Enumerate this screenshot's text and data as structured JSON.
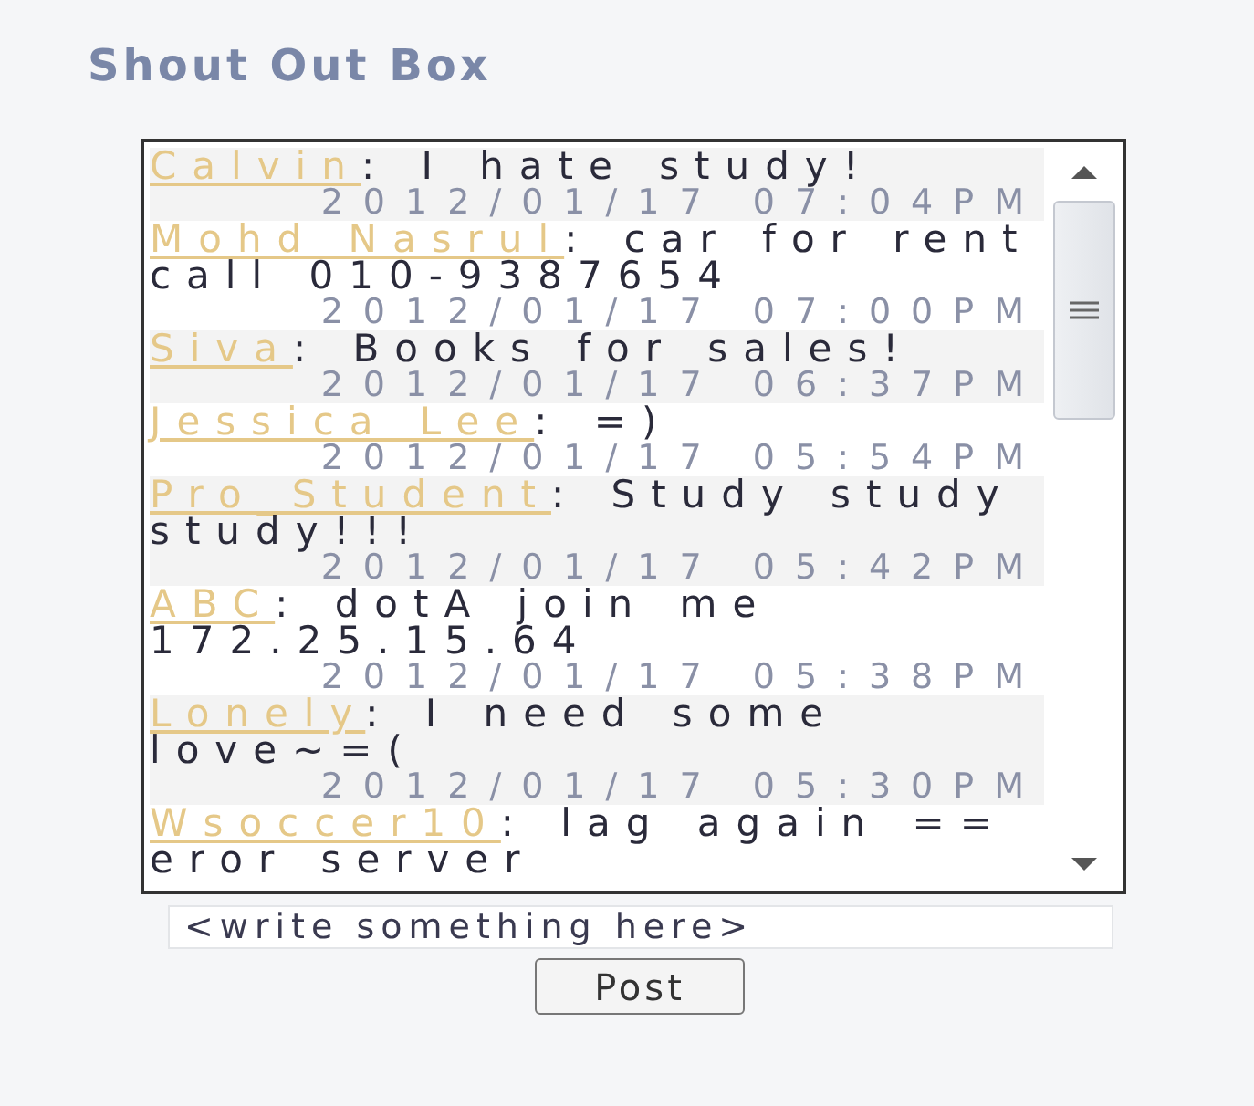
{
  "title": "Shout Out Box",
  "messages": [
    {
      "name": "Calvin",
      "text": ": I hate study!",
      "time": "2012/01/17 07:04PM"
    },
    {
      "name": "Mohd Nasrul",
      "text": ": car for rent call 010-9387654",
      "time": "2012/01/17 07:00PM"
    },
    {
      "name": "Siva",
      "text": ": Books for sales!",
      "time": "2012/01/17 06:37PM"
    },
    {
      "name": "Jessica Lee",
      "text": ": =)",
      "time": "2012/01/17 05:54PM"
    },
    {
      "name": "Pro_Student",
      "text": ": Study study study!!!",
      "time": "2012/01/17 05:42PM"
    },
    {
      "name": "ABC",
      "text": ": dotA join me 172.25.15.64",
      "time": "2012/01/17 05:38PM"
    },
    {
      "name": "Lonely",
      "text": ": I need some love~=(",
      "time": "2012/01/17 05:30PM"
    },
    {
      "name": "Wsoccer10",
      "text": ": lag again == eror server"
    }
  ],
  "input": {
    "placeholder": "<write something here>"
  },
  "button": "Post"
}
